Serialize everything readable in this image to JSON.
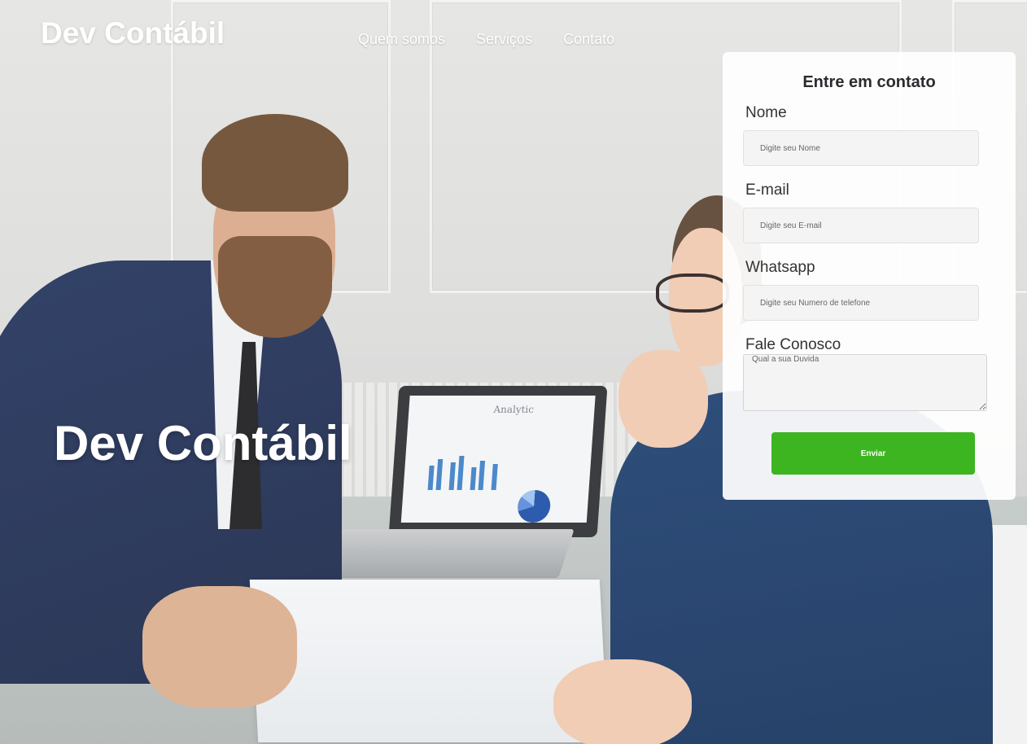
{
  "header": {
    "logo": "Dev Contábil",
    "nav": [
      {
        "label": "Quem somos"
      },
      {
        "label": "Serviços"
      },
      {
        "label": "Contato"
      }
    ]
  },
  "hero": {
    "title": "Dev Contábil",
    "laptop_screen_title": "Analytic"
  },
  "contact_form": {
    "title": "Entre em contato",
    "name": {
      "label": "Nome",
      "placeholder": "Digite seu Nome"
    },
    "email": {
      "label": "E-mail",
      "placeholder": "Digite seu E-mail"
    },
    "whatsapp": {
      "label": "Whatsapp",
      "placeholder": "Digite seu Numero de telefone"
    },
    "message": {
      "label": "Fale Conosco",
      "placeholder": "Qual a sua Duvida"
    },
    "submit_label": "Enviar",
    "submit_color": "#3cb521"
  }
}
